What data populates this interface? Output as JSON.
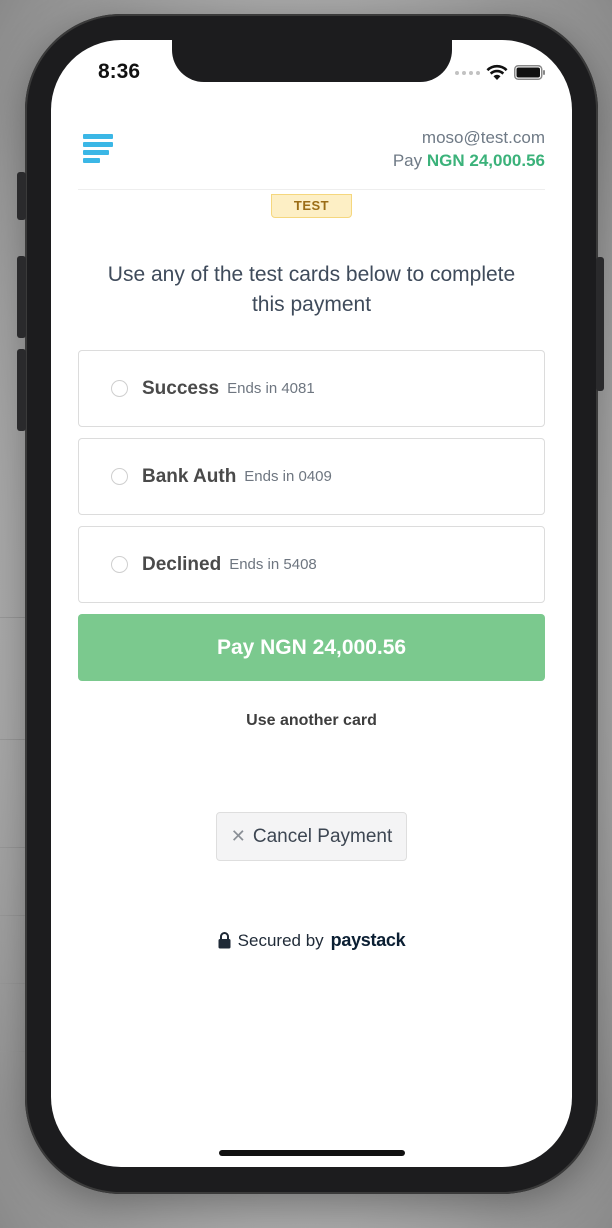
{
  "status_bar": {
    "time": "8:36",
    "icons": [
      "signal-dots-icon",
      "wifi-icon",
      "battery-icon"
    ]
  },
  "header": {
    "logo": "paystack-logo-icon",
    "email": "moso@test.com",
    "pay_prefix": "Pay",
    "pay_amount": "NGN 24,000.56",
    "amount_color": "#3bb27a"
  },
  "badge": "TEST",
  "intro_text": "Use any of the test cards below to complete this payment",
  "cards": [
    {
      "name": "Success",
      "ends": "Ends in 4081"
    },
    {
      "name": "Bank Auth",
      "ends": "Ends in 0409"
    },
    {
      "name": "Declined",
      "ends": "Ends in 5408"
    }
  ],
  "pay_button": {
    "label": "Pay NGN 24,000.56",
    "color": "#7bc98e"
  },
  "use_another_card": "Use another card",
  "cancel_button": {
    "label": "Cancel Payment",
    "icon": "close-icon"
  },
  "footer": {
    "secured_by": "Secured by",
    "brand": "paystack",
    "icon": "lock-icon"
  }
}
